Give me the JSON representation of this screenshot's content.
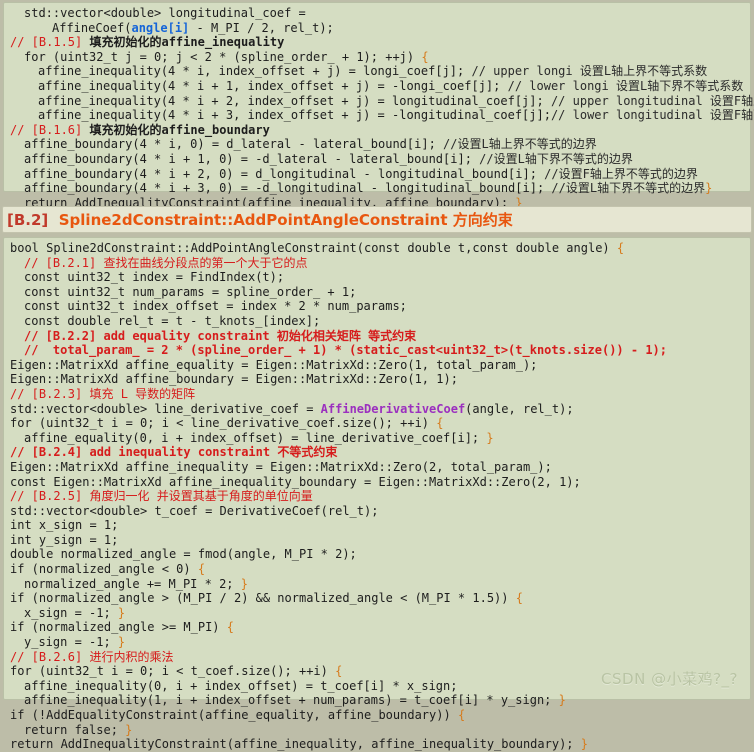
{
  "page": {
    "background_color": "#bdbda8",
    "code_background_color": "#d5ddc2",
    "header_background_color": "#e6e6d2",
    "comment_red": "#d61c1c",
    "header_tag_color": "#c0392b",
    "header_title_color": "#e8560f"
  },
  "watermark": {
    "text": "CSDN @小菜鸡?_?"
  },
  "block_b1": {
    "lines": [
      {
        "indent": 1,
        "segments": [
          {
            "text": "std::vector<double> longitudinal_coef =",
            "style": "plain"
          }
        ]
      },
      {
        "indent": 3,
        "segments": [
          {
            "text": "AffineCoef(",
            "style": "plain"
          },
          {
            "text": "angle[i]",
            "style": "blue"
          },
          {
            "text": " - M_PI / 2, rel_t);",
            "style": "plain"
          }
        ]
      },
      {
        "indent": 0,
        "segments": [
          {
            "text": "// [B.1.5] ",
            "style": "red"
          },
          {
            "text": "填充初始化的affine_inequality",
            "style": "cn"
          }
        ]
      },
      {
        "indent": 1,
        "segments": [
          {
            "text": "for (uint32_t j = 0; j < 2 * (spline_order_ + 1); ++j) ",
            "style": "plain"
          },
          {
            "text": "{",
            "style": "brace"
          }
        ]
      },
      {
        "indent": 2,
        "segments": [
          {
            "text": "affine_inequality(4 * i, index_offset + j) = longi_coef[j]; ",
            "style": "plain"
          },
          {
            "text": "// upper longi 设置L轴上界不等式系数",
            "style": "comment"
          }
        ]
      },
      {
        "indent": 2,
        "segments": [
          {
            "text": "affine_inequality(4 * i + 1, index_offset + j) = -longi_coef[j]; ",
            "style": "plain"
          },
          {
            "text": "// lower longi 设置L轴下界不等式系数",
            "style": "comment"
          }
        ]
      },
      {
        "indent": 2,
        "segments": [
          {
            "text": "affine_inequality(4 * i + 2, index_offset + j) = longitudinal_coef[j]; ",
            "style": "plain"
          },
          {
            "text": "// upper longitudinal 设置F轴上界不等式系数",
            "style": "comment"
          }
        ]
      },
      {
        "indent": 2,
        "segments": [
          {
            "text": "affine_inequality(4 * i + 3, index_offset + j) = -longitudinal_coef[j];",
            "style": "plain"
          },
          {
            "text": "// lower longitudinal 设置F轴下界不等式系数",
            "style": "comment"
          },
          {
            "text": "}",
            "style": "brace"
          }
        ]
      },
      {
        "indent": 0,
        "segments": [
          {
            "text": "// [B.1.6] ",
            "style": "red"
          },
          {
            "text": "填充初始化的affine_boundary",
            "style": "cn"
          }
        ]
      },
      {
        "indent": 1,
        "segments": [
          {
            "text": "affine_boundary(4 * i, 0) = d_lateral - lateral_bound[i]; ",
            "style": "plain"
          },
          {
            "text": "//设置L轴上界不等式的边界",
            "style": "comment"
          }
        ]
      },
      {
        "indent": 1,
        "segments": [
          {
            "text": "affine_boundary(4 * i + 1, 0) = -d_lateral - lateral_bound[i]; ",
            "style": "plain"
          },
          {
            "text": "//设置L轴下界不等式的边界",
            "style": "comment"
          }
        ]
      },
      {
        "indent": 1,
        "segments": [
          {
            "text": "affine_boundary(4 * i + 2, 0) = d_longitudinal - longitudinal_bound[i]; ",
            "style": "plain"
          },
          {
            "text": "//设置F轴上界不等式的边界",
            "style": "comment"
          }
        ]
      },
      {
        "indent": 1,
        "segments": [
          {
            "text": "affine_boundary(4 * i + 3, 0) = -d_longitudinal - longitudinal_bound[i]; ",
            "style": "plain"
          },
          {
            "text": "//设置L轴下界不等式的边界",
            "style": "comment"
          },
          {
            "text": "}",
            "style": "brace"
          }
        ]
      },
      {
        "indent": 1,
        "segments": [
          {
            "text": "return AddInequalityConstraint(affine_inequality, affine_boundary); ",
            "style": "plain"
          },
          {
            "text": "}",
            "style": "brace"
          }
        ]
      }
    ]
  },
  "header_b2": {
    "tag": "[B.2]",
    "title": "Spline2dConstraint::AddPointAngleConstraint 方向约束"
  },
  "block_b2": {
    "lines": [
      {
        "indent": 0,
        "segments": [
          {
            "text": "bool Spline2dConstraint::AddPointAngleConstraint(const double t,const double angle) ",
            "style": "plain"
          },
          {
            "text": "{",
            "style": "brace"
          }
        ]
      },
      {
        "indent": 1,
        "segments": [
          {
            "text": "// [B.2.1] ",
            "style": "red"
          },
          {
            "text": "查找在曲线分段点的第一个大于它的点",
            "style": "red"
          }
        ]
      },
      {
        "indent": 1,
        "segments": [
          {
            "text": "const uint32_t index = FindIndex(t);",
            "style": "plain"
          }
        ]
      },
      {
        "indent": 1,
        "segments": [
          {
            "text": "const uint32_t num_params = spline_order_ + 1;",
            "style": "plain"
          }
        ]
      },
      {
        "indent": 1,
        "segments": [
          {
            "text": "const uint32_t index_offset = index * 2 * num_params;",
            "style": "plain"
          }
        ]
      },
      {
        "indent": 1,
        "segments": [
          {
            "text": "const double rel_t = t - t_knots_[index];",
            "style": "plain"
          }
        ]
      },
      {
        "indent": 1,
        "segments": [
          {
            "text": "// [B.2.2] add equality constraint ",
            "style": "redb"
          },
          {
            "text": "初始化相关矩阵 等式约束",
            "style": "redb"
          }
        ]
      },
      {
        "indent": 1,
        "segments": [
          {
            "text": "//  total_param_ = 2 * (spline_order_ + 1) * (static_cast<uint32_t>(t_knots.size()) - 1);",
            "style": "redb"
          }
        ]
      },
      {
        "indent": 0,
        "segments": [
          {
            "text": "Eigen::MatrixXd affine_equality = Eigen::MatrixXd::Zero(1, total_param_);",
            "style": "plain"
          }
        ]
      },
      {
        "indent": 0,
        "segments": [
          {
            "text": "Eigen::MatrixXd affine_boundary = Eigen::MatrixXd::Zero(1, 1);",
            "style": "plain"
          }
        ]
      },
      {
        "indent": 0,
        "segments": [
          {
            "text": "// [B.2.3] ",
            "style": "red"
          },
          {
            "text": "填充 L 导数的矩阵",
            "style": "red"
          }
        ]
      },
      {
        "indent": 0,
        "segments": [
          {
            "text": "std::vector<double> line_derivative_coef = ",
            "style": "plain"
          },
          {
            "text": "AffineDerivativeCoef",
            "style": "purple"
          },
          {
            "text": "(angle, rel_t);",
            "style": "plain"
          }
        ]
      },
      {
        "indent": 0,
        "segments": [
          {
            "text": "for (uint32_t i = 0; i < line_derivative_coef.size(); ++i) ",
            "style": "plain"
          },
          {
            "text": "{",
            "style": "brace"
          }
        ]
      },
      {
        "indent": 1,
        "segments": [
          {
            "text": "affine_equality(0, i + index_offset) = line_derivative_coef[i]; ",
            "style": "plain"
          },
          {
            "text": "}",
            "style": "brace"
          }
        ]
      },
      {
        "indent": 0,
        "segments": [
          {
            "text": "// [B.2.4] add inequality constraint ",
            "style": "redb"
          },
          {
            "text": "不等式约束",
            "style": "redb"
          }
        ]
      },
      {
        "indent": 0,
        "segments": [
          {
            "text": "Eigen::MatrixXd affine_inequality = Eigen::MatrixXd::Zero(2, total_param_);",
            "style": "plain"
          }
        ]
      },
      {
        "indent": 0,
        "segments": [
          {
            "text": "const Eigen::MatrixXd affine_inequality_boundary = Eigen::MatrixXd::Zero(2, 1);",
            "style": "plain"
          }
        ]
      },
      {
        "indent": 0,
        "segments": [
          {
            "text": "// [B.2.5] ",
            "style": "red"
          },
          {
            "text": "角度归一化 并设置其基于角度的单位向量",
            "style": "red"
          }
        ]
      },
      {
        "indent": 0,
        "segments": [
          {
            "text": "std::vector<double> t_coef = DerivativeCoef(rel_t);",
            "style": "plain"
          }
        ]
      },
      {
        "indent": 0,
        "segments": [
          {
            "text": "int x_sign = 1;",
            "style": "plain"
          }
        ]
      },
      {
        "indent": 0,
        "segments": [
          {
            "text": "int y_sign = 1;",
            "style": "plain"
          }
        ]
      },
      {
        "indent": 0,
        "segments": [
          {
            "text": "double normalized_angle = fmod(angle, M_PI * 2);",
            "style": "plain"
          }
        ]
      },
      {
        "indent": 0,
        "segments": [
          {
            "text": "if (normalized_angle < 0) ",
            "style": "plain"
          },
          {
            "text": "{",
            "style": "brace"
          }
        ]
      },
      {
        "indent": 1,
        "segments": [
          {
            "text": "normalized_angle += M_PI * 2; ",
            "style": "plain"
          },
          {
            "text": "}",
            "style": "brace"
          }
        ]
      },
      {
        "indent": 0,
        "segments": [
          {
            "text": "if (normalized_angle > (M_PI / 2) && normalized_angle < (M_PI * 1.5)) ",
            "style": "plain"
          },
          {
            "text": "{",
            "style": "brace"
          }
        ]
      },
      {
        "indent": 1,
        "segments": [
          {
            "text": "x_sign = -1; ",
            "style": "plain"
          },
          {
            "text": "}",
            "style": "brace"
          }
        ]
      },
      {
        "indent": 0,
        "segments": [
          {
            "text": "if (normalized_angle >= M_PI) ",
            "style": "plain"
          },
          {
            "text": "{",
            "style": "brace"
          }
        ]
      },
      {
        "indent": 1,
        "segments": [
          {
            "text": "y_sign = -1; ",
            "style": "plain"
          },
          {
            "text": "}",
            "style": "brace"
          }
        ]
      },
      {
        "indent": 0,
        "segments": [
          {
            "text": "// [B.2.6] ",
            "style": "red"
          },
          {
            "text": "进行内积的乘法",
            "style": "red"
          }
        ]
      },
      {
        "indent": 0,
        "segments": [
          {
            "text": "for (uint32_t i = 0; i < t_coef.size(); ++i) ",
            "style": "plain"
          },
          {
            "text": "{",
            "style": "brace"
          }
        ]
      },
      {
        "indent": 1,
        "segments": [
          {
            "text": "affine_inequality(0, i + index_offset) = t_coef[i] * x_sign;",
            "style": "plain"
          }
        ]
      },
      {
        "indent": 1,
        "segments": [
          {
            "text": "affine_inequality(1, i + index_offset + num_params) = t_coef[i] * y_sign; ",
            "style": "plain"
          },
          {
            "text": "}",
            "style": "brace"
          }
        ]
      },
      {
        "indent": 0,
        "segments": [
          {
            "text": "if (!AddEqualityConstraint(affine_equality, affine_boundary)) ",
            "style": "plain"
          },
          {
            "text": "{",
            "style": "brace"
          }
        ]
      },
      {
        "indent": 1,
        "segments": [
          {
            "text": "return false; ",
            "style": "plain"
          },
          {
            "text": "}",
            "style": "brace"
          }
        ]
      },
      {
        "indent": 0,
        "segments": [
          {
            "text": "return AddInequalityConstraint(affine_inequality, affine_inequality_boundary); ",
            "style": "plain"
          },
          {
            "text": "}",
            "style": "brace"
          }
        ]
      }
    ]
  }
}
